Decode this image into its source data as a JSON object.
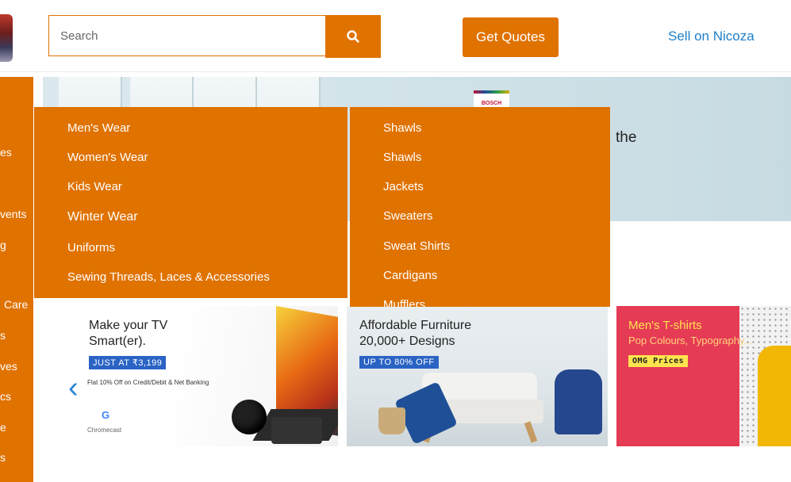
{
  "header": {
    "search_placeholder": "Search",
    "get_quotes": "Get Quotes",
    "sell_link": "Sell on Nicoza"
  },
  "sidebar": {
    "items": [
      "es",
      "vents",
      "g",
      "Care",
      "s",
      "ves",
      "cs",
      "e",
      "s"
    ]
  },
  "banner": {
    "partial_text": "the",
    "brand_badge": "BOSCH"
  },
  "dropdown": {
    "categories": [
      "Men's Wear",
      "Women's Wear",
      "Kids Wear",
      "Winter Wear",
      "Uniforms",
      "Sewing Threads, Laces & Accessories"
    ],
    "subcategories": [
      "Shawls",
      "Shawls",
      "Jackets",
      "Sweaters",
      "Sweat Shirts",
      "Cardigans",
      "Mufflers"
    ]
  },
  "cards": [
    {
      "title_line1": "Make your TV",
      "title_line2": "Smart(er).",
      "tag": "JUST AT ₹3,199",
      "note": "Flat 10% Off on Credit/Debit & Net Banking",
      "brand": "Chromecast"
    },
    {
      "title_line1": "Affordable Furniture",
      "title_line2": "20,000+ Designs",
      "tag": "UP TO 80% OFF"
    },
    {
      "title_line1": "Men's T-shirts",
      "subtitle": "Pop Colours, Typography...",
      "tag": "OMG Prices"
    }
  ],
  "colors": {
    "accent": "#e07200",
    "link": "#1e7fc8",
    "tag_blue": "#2a63c4",
    "card_red": "#e63b55"
  }
}
